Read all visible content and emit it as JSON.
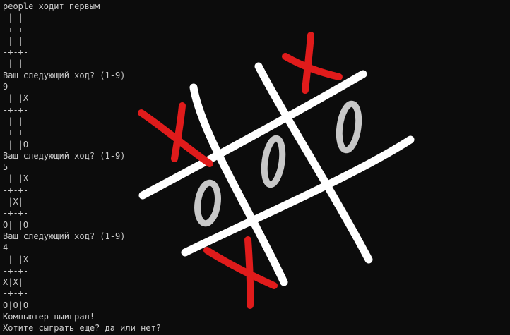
{
  "console": {
    "lines": [
      "people ходит первым",
      " | |",
      "-+-+-",
      " | |",
      "-+-+-",
      " | |",
      "Ваш следующий ход? (1-9)",
      "9",
      " | |X",
      "-+-+-",
      " | |",
      "-+-+-",
      " | |O",
      "Ваш следующий ход? (1-9)",
      "5",
      " | |X",
      "-+-+-",
      " |X|",
      "-+-+-",
      "O| |O",
      "Ваш следующий ход? (1-9)",
      "4",
      " | |X",
      "-+-+-",
      "X|X|",
      "-+-+-",
      "O|O|O",
      "Компьютер выиграл!",
      "Хотите сыграть еще? да или нет?"
    ]
  },
  "drawing": {
    "grid_color": "#ffffff",
    "x_color": "#e01b1b",
    "o_color": "#c8c8c8"
  }
}
